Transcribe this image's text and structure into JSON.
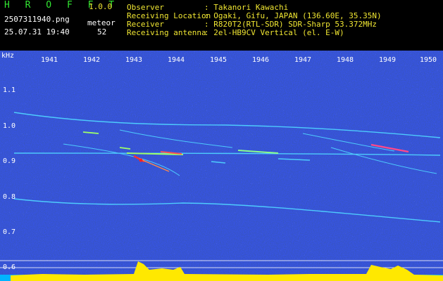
{
  "app": {
    "name": "H R O F F T",
    "version": "1.0.0",
    "filename": "2507311940.png",
    "datetime": "25.07.31 19:40",
    "meteor_label": "meteor",
    "meteor_count": "52"
  },
  "info": {
    "rows": [
      {
        "label": "Observer",
        "value": ": Takanori Kawachi"
      },
      {
        "label": "Receiving Location",
        "value": ": Ogaki, Gifu, JAPAN (136.60E, 35.35N)"
      },
      {
        "label": "Receiver",
        "value": ": R820T2(RTL-SDR) SDR-Sharp 53.372MHz"
      },
      {
        "label": "Receiving antenna",
        "value": ": 2el-HB9CV Vertical (el. E-W)"
      }
    ]
  },
  "axes": {
    "y_unit": "kHz",
    "y_ticks": [
      "1.1",
      "1.0",
      "0.9",
      "0.8",
      "0.7",
      "0.6"
    ],
    "x_ticks": [
      "1941",
      "1942",
      "1943",
      "1944",
      "1945",
      "1946",
      "1947",
      "1948",
      "1949",
      "1950"
    ]
  },
  "colors": {
    "background": "#000000",
    "spectrogram_bg": "#0a0f6e",
    "trace": "#4fd2ff",
    "meteor_hot": "#ff3030",
    "level_bar": "#ffe800",
    "baseline": "#00c8ff"
  }
}
